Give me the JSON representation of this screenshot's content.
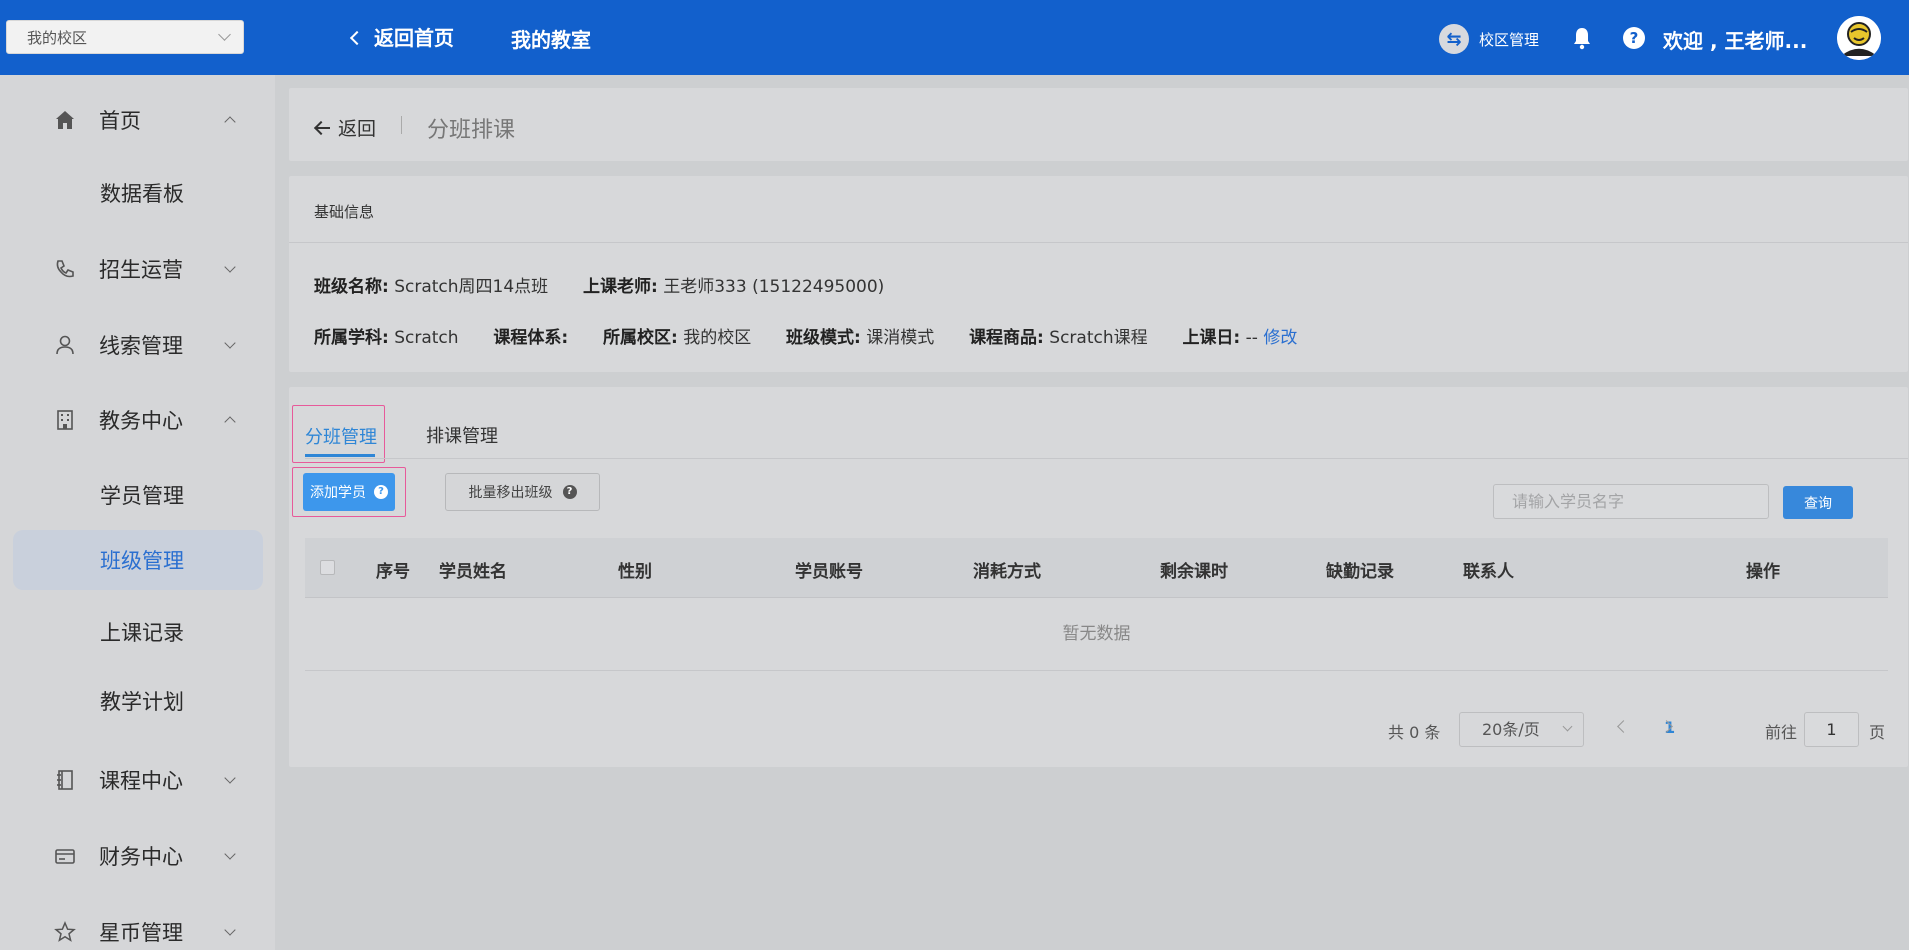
{
  "topbar": {
    "campus_select": "我的校区",
    "back_home": "返回首页",
    "my_class": "我的教室",
    "campus_mgmt": "校区管理",
    "welcome": "欢迎 , 王老师...",
    "bg_color": "#1260cc"
  },
  "sidebar": {
    "items": [
      {
        "label": "首页",
        "icon": "home-icon",
        "expanded": true
      },
      {
        "label": "数据看板"
      },
      {
        "label": "招生运营",
        "icon": "phone-icon",
        "expanded": false
      },
      {
        "label": "线索管理",
        "icon": "user-icon",
        "expanded": false
      },
      {
        "label": "教务中心",
        "icon": "building-icon",
        "expanded": true
      },
      {
        "label": "学员管理"
      },
      {
        "label": "班级管理",
        "active": true
      },
      {
        "label": "上课记录"
      },
      {
        "label": "教学计划"
      },
      {
        "label": "课程中心",
        "icon": "book-icon",
        "expanded": false
      },
      {
        "label": "财务中心",
        "icon": "card-icon",
        "expanded": false
      },
      {
        "label": "星币管理",
        "icon": "star-icon",
        "expanded": false
      }
    ]
  },
  "header": {
    "back": "返回",
    "title": "分班排课"
  },
  "info": {
    "section_title": "基础信息",
    "class_name_label": "班级名称:",
    "class_name": "Scratch周四14点班",
    "teacher_label": "上课老师:",
    "teacher": "王老师333 (15122495000)",
    "subject_label": "所属学科:",
    "subject": "Scratch",
    "system_label": "课程体系:",
    "system": "",
    "campus_label": "所属校区:",
    "campus": "我的校区",
    "mode_label": "班级模式:",
    "mode": "课消模式",
    "product_label": "课程商品:",
    "product": "Scratch课程",
    "day_label": "上课日:",
    "day": "--",
    "edit": "修改"
  },
  "tabs": {
    "active": "分班管理",
    "other": "排课管理"
  },
  "toolbar": {
    "add_student": "添加学员",
    "batch_remove": "批量移出班级",
    "search_placeholder": "请输入学员名字",
    "query": "查询"
  },
  "table": {
    "columns": [
      "序号",
      "学员姓名",
      "性别",
      "学员账号",
      "消耗方式",
      "剩余课时",
      "缺勤记录",
      "联系人",
      "操作"
    ],
    "empty": "暂无数据"
  },
  "pagination": {
    "total": "共 0 条",
    "page_size": "20条/页",
    "current": "1",
    "goto_label": "前往",
    "goto_value": "1",
    "goto_unit": "页"
  }
}
